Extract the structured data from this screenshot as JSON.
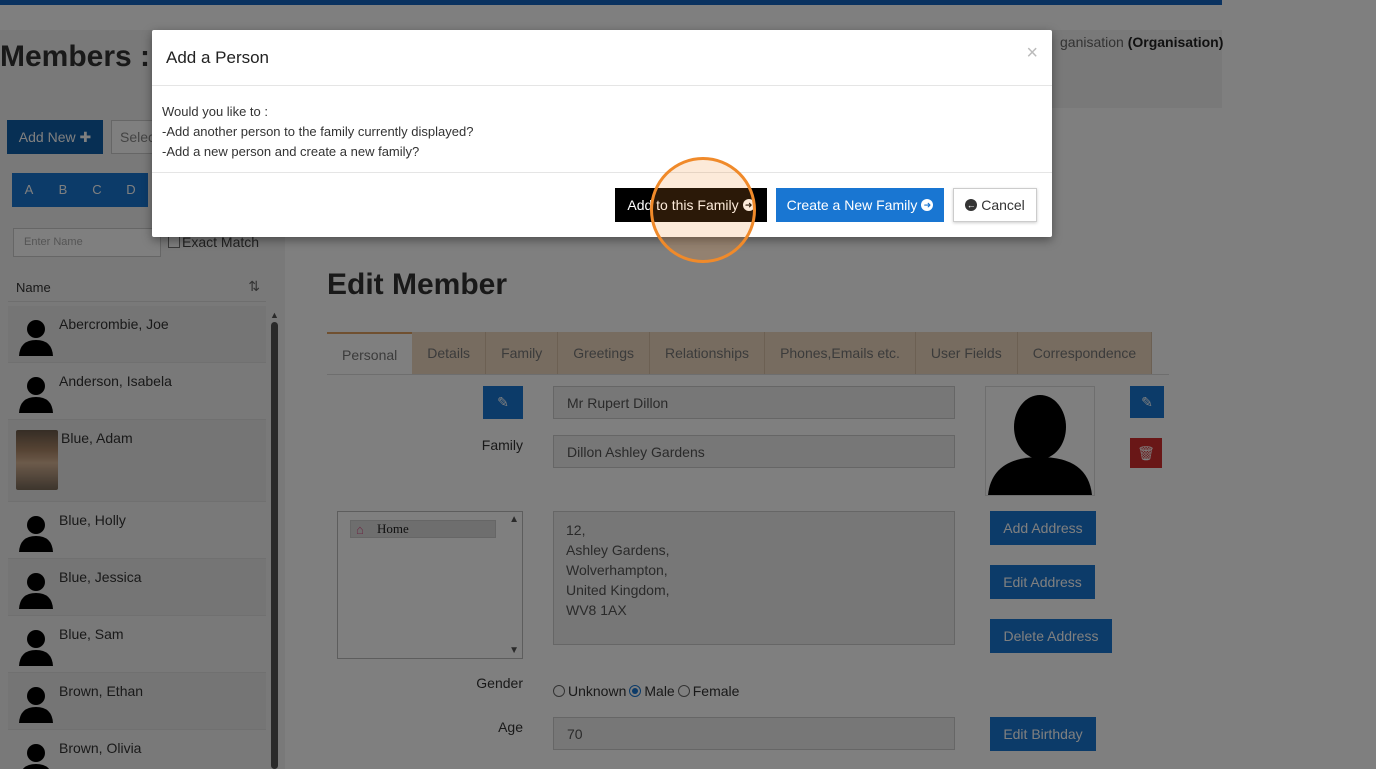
{
  "page": {
    "title": "Members :",
    "org_prefix": "ganisation",
    "org_name": "(Organisation)"
  },
  "left": {
    "add_new": "Add New",
    "select_placeholder": "Selec",
    "alpha": [
      "A",
      "B",
      "C",
      "D"
    ],
    "name_placeholder": "Enter Name",
    "exact_match": "Exact Match",
    "name_header": "Name",
    "members": [
      "Abercrombie, Joe",
      "Anderson, Isabela",
      "Blue, Adam",
      "Blue, Holly",
      "Blue, Jessica",
      "Blue, Sam",
      "Brown, Ethan",
      "Brown, Olivia"
    ]
  },
  "edit": {
    "title": "Edit Member",
    "tabs": [
      "Personal",
      "Details",
      "Family",
      "Greetings",
      "Relationships",
      "Phones,Emails etc.",
      "User Fields",
      "Correspondence"
    ],
    "name_value": "Mr Rupert Dillon",
    "family_label": "Family",
    "family_value": "Dillon Ashley Gardens",
    "address_item": "Home",
    "address_lines": [
      "12,",
      "Ashley Gardens,",
      "Wolverhampton,",
      "United Kingdom,",
      "WV8 1AX"
    ],
    "add_address": "Add Address",
    "edit_address": "Edit Address",
    "delete_address": "Delete Address",
    "gender_label": "Gender",
    "gender_options": [
      "Unknown",
      "Male",
      "Female"
    ],
    "gender_selected": "Male",
    "age_label": "Age",
    "age_value": "70",
    "edit_birthday": "Edit Birthday"
  },
  "modal": {
    "title": "Add a Person",
    "close": "×",
    "line1": "Would you like to :",
    "line2": "-Add another person to the family currently displayed?",
    "line3": "-Add a new person and create a new family?",
    "add_family_btn": "Add to this Family",
    "create_family_btn": "Create a New Family",
    "cancel_btn": "Cancel"
  },
  "colors": {
    "primary": "#1976d2",
    "dark_blue": "#0e5ea8",
    "danger": "#d32f2f",
    "tab_bg": "#efd9c1",
    "highlight_ring": "#f08a2a"
  }
}
